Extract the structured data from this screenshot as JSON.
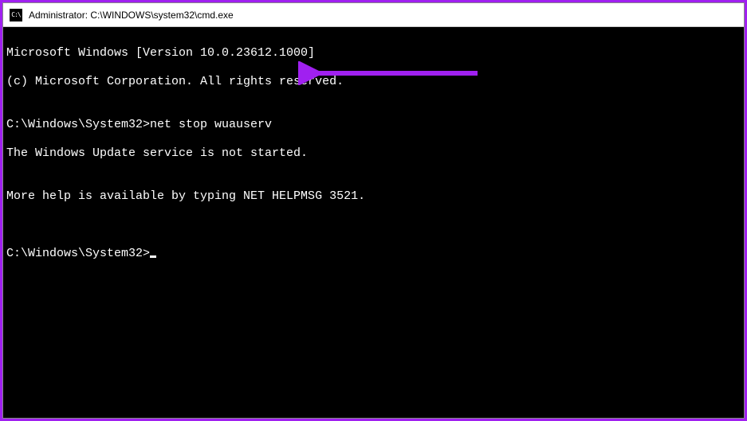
{
  "window": {
    "title": "Administrator: C:\\WINDOWS\\system32\\cmd.exe",
    "icon_name": "cmd-icon"
  },
  "terminal": {
    "lines": {
      "version": "Microsoft Windows [Version 10.0.23612.1000]",
      "copyright": "(c) Microsoft Corporation. All rights reserved.",
      "blank1": "",
      "prompt1_path": "C:\\Windows\\System32>",
      "prompt1_command": "net stop wuauserv",
      "response1": "The Windows Update service is not started.",
      "blank2": "",
      "response2": "More help is available by typing NET HELPMSG 3521.",
      "blank3": "",
      "blank4": "",
      "prompt2_path": "C:\\Windows\\System32>"
    }
  },
  "annotation": {
    "color": "#a020f0"
  }
}
